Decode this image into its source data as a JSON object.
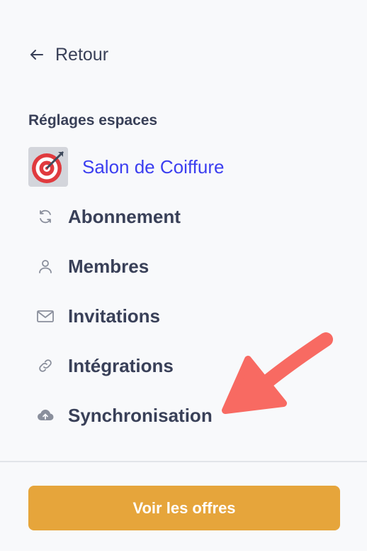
{
  "nav": {
    "back_label": "Retour"
  },
  "settings": {
    "section_title": "Réglages espaces",
    "space": {
      "name": "Salon de Coiffure",
      "icon": "target-dart-icon"
    },
    "items": [
      {
        "label": "Abonnement",
        "icon": "refresh-icon"
      },
      {
        "label": "Membres",
        "icon": "user-icon"
      },
      {
        "label": "Invitations",
        "icon": "mail-icon"
      },
      {
        "label": "Intégrations",
        "icon": "link-icon"
      },
      {
        "label": "Synchronisation",
        "icon": "cloud-upload-icon"
      }
    ]
  },
  "footer": {
    "cta_label": "Voir les offres"
  },
  "colors": {
    "accent_link": "#3b3ef0",
    "cta_background": "#e6a53b",
    "annotation_arrow": "#f86a62",
    "text": "#394058"
  }
}
